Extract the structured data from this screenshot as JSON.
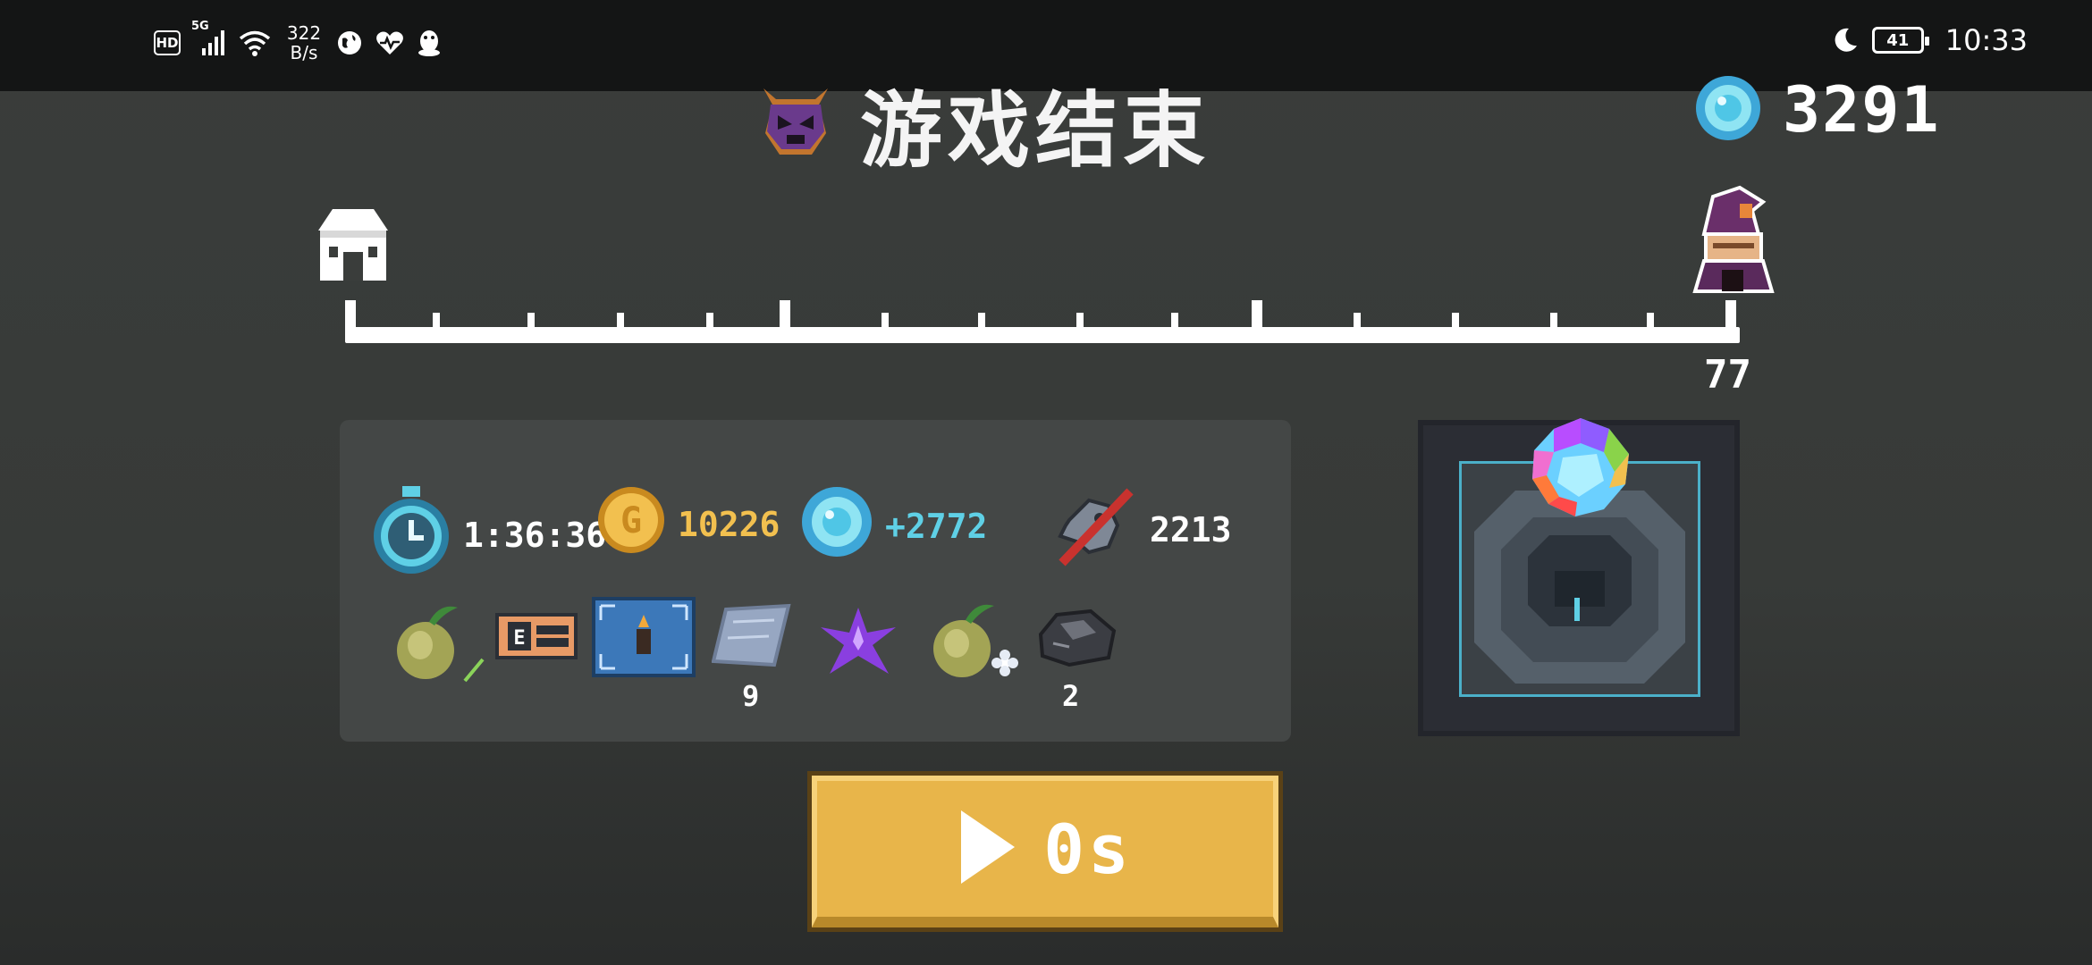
{
  "status_bar": {
    "hd": "HD",
    "network": "5G",
    "speed_value": "322",
    "speed_unit": "B/s",
    "battery": "41",
    "time": "10:33"
  },
  "header": {
    "title": "游戏结束",
    "gem_total": "3291"
  },
  "progress": {
    "level": "77"
  },
  "stats": {
    "time": "1:36:36",
    "gold": "10226",
    "gems_gained": "+2772",
    "kills": "2213"
  },
  "items": [
    {
      "name": "seed-sprout-1",
      "count": ""
    },
    {
      "name": "card",
      "count": ""
    },
    {
      "name": "blueprint",
      "count": ""
    },
    {
      "name": "cloth",
      "count": "9"
    },
    {
      "name": "purple-crystal",
      "count": ""
    },
    {
      "name": "seed-sprout-2",
      "count": ""
    },
    {
      "name": "ore",
      "count": "2"
    }
  ],
  "button": {
    "label": "0s"
  },
  "colors": {
    "gold": "#f2c04f",
    "gem": "#5fd0e6",
    "button": "#e8b54a"
  }
}
